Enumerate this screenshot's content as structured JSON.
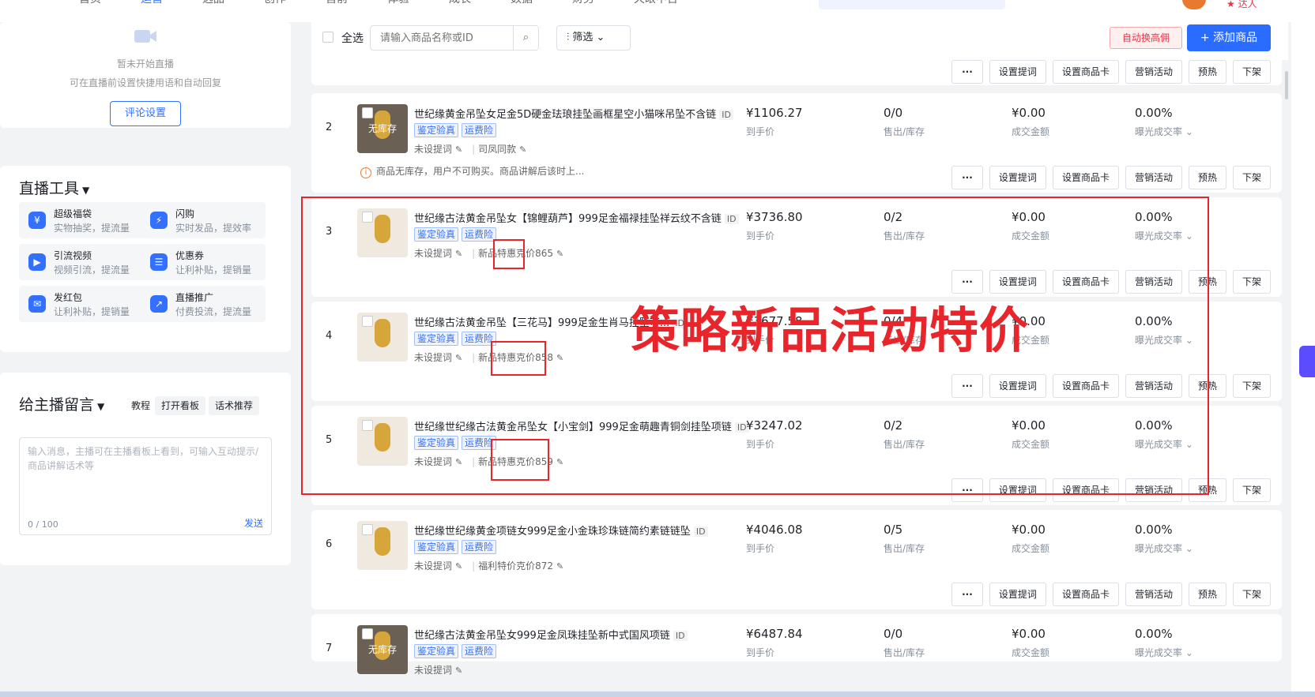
{
  "top_nav": [
    "首页",
    "运营",
    "选品",
    "创作",
    "售前",
    "体验",
    "成长",
    "数据",
    "财务",
    "天眼中台"
  ],
  "top_right": {
    "talent": "达人"
  },
  "left": {
    "no_live": "暂未开始直播",
    "hint": "可在直播前设置快捷用语和自动回复",
    "comment_btn": "评论设置",
    "tools_title": "直播工具",
    "tools": [
      {
        "name": "超级福袋",
        "desc": "实物抽奖，提流量",
        "icon": "gift-bag-icon"
      },
      {
        "name": "闪购",
        "desc": "实时发品，提效率",
        "icon": "flash-bag-icon"
      },
      {
        "name": "引流视频",
        "desc": "视频引流，提流量",
        "icon": "video-icon"
      },
      {
        "name": "优惠券",
        "desc": "让利补贴，提销量",
        "icon": "coupon-icon"
      },
      {
        "name": "发红包",
        "desc": "让利补贴，提销量",
        "icon": "red-packet-icon"
      },
      {
        "name": "直播推广",
        "desc": "付费投流，提流量",
        "icon": "promote-icon"
      }
    ],
    "msg_title": "给主播留言",
    "msg_tutorial": "教程",
    "msg_open_board": "打开看板",
    "msg_script": "话术推荐",
    "msg_placeholder": "输入消息，主播可在主播看板上看到，可输入互动提示/商品讲解话术等",
    "msg_count": "0 / 100",
    "msg_send": "发送"
  },
  "toolbar": {
    "select_all": "全选",
    "search_placeholder": "请输入商品名称或ID",
    "filter": "筛选",
    "auto_swap": "自动换高佣",
    "add": "+ 添加商品"
  },
  "labels": {
    "price": "到手价",
    "sold": "售出/库存",
    "amount": "成交金额",
    "rate": "曝光成交率 ⌄",
    "no_prompt": "未设提词",
    "verify": "鉴定验真",
    "shipping": "运费险",
    "no_stock": "无库存",
    "warning": "商品无库存，用户不可购买。商品讲解后该时上..."
  },
  "actions": [
    "···",
    "设置提词",
    "设置商品卡",
    "营销活动",
    "预热",
    "下架"
  ],
  "rows": [
    {
      "index": "2",
      "title": "世纪缘黄金吊坠女足金5D硬金珐琅挂坠画框星空小猫咪吊坠不含链",
      "id_badge": "ID",
      "price": "¥1106.27",
      "sold": "0/0",
      "amount": "¥0.00",
      "rate": "0.00%",
      "extra": "司凤同款"
    },
    {
      "index": "3",
      "title": "世纪缘古法黄金吊坠女【锦鲤葫芦】999足金福禄挂坠祥云纹不含链",
      "id_badge": "ID",
      "price": "¥3736.80",
      "sold": "0/2",
      "amount": "¥0.00",
      "rate": "0.00%",
      "extra": "新品特惠克价865"
    },
    {
      "index": "4",
      "title": "世纪缘古法黄金吊坠【三花马】999足金生肖马挂坠可...",
      "id_badge": "ID",
      "price": "¥3677.58",
      "sold": "0/4",
      "amount": "¥0.00",
      "rate": "0.00%",
      "extra": "新品特惠克价858"
    },
    {
      "index": "5",
      "title": "世纪缘世纪缘古法黄金吊坠女【小宝剑】999足金萌趣青铜剑挂坠项链",
      "id_badge": "ID",
      "price": "¥3247.02",
      "sold": "0/2",
      "amount": "¥0.00",
      "rate": "0.00%",
      "extra": "新品特惠克价859"
    },
    {
      "index": "6",
      "title": "世纪缘世纪缘黄金项链女999足金小金珠珍珠链简约素链链坠",
      "id_badge": "ID",
      "price": "¥4046.08",
      "sold": "0/5",
      "amount": "¥0.00",
      "rate": "0.00%",
      "extra": "福利特价克价872"
    },
    {
      "index": "7",
      "title": "世纪缘古法黄金吊坠女999足金凤珠挂坠新中式国风项链",
      "id_badge": "ID",
      "price": "¥6487.84",
      "sold": "0/0",
      "amount": "¥0.00",
      "rate": "0.00%",
      "extra": ""
    }
  ],
  "annotation": "策略新品活动特价",
  "colors": {
    "accent": "#3370ff",
    "annotation": "#e8252b"
  }
}
